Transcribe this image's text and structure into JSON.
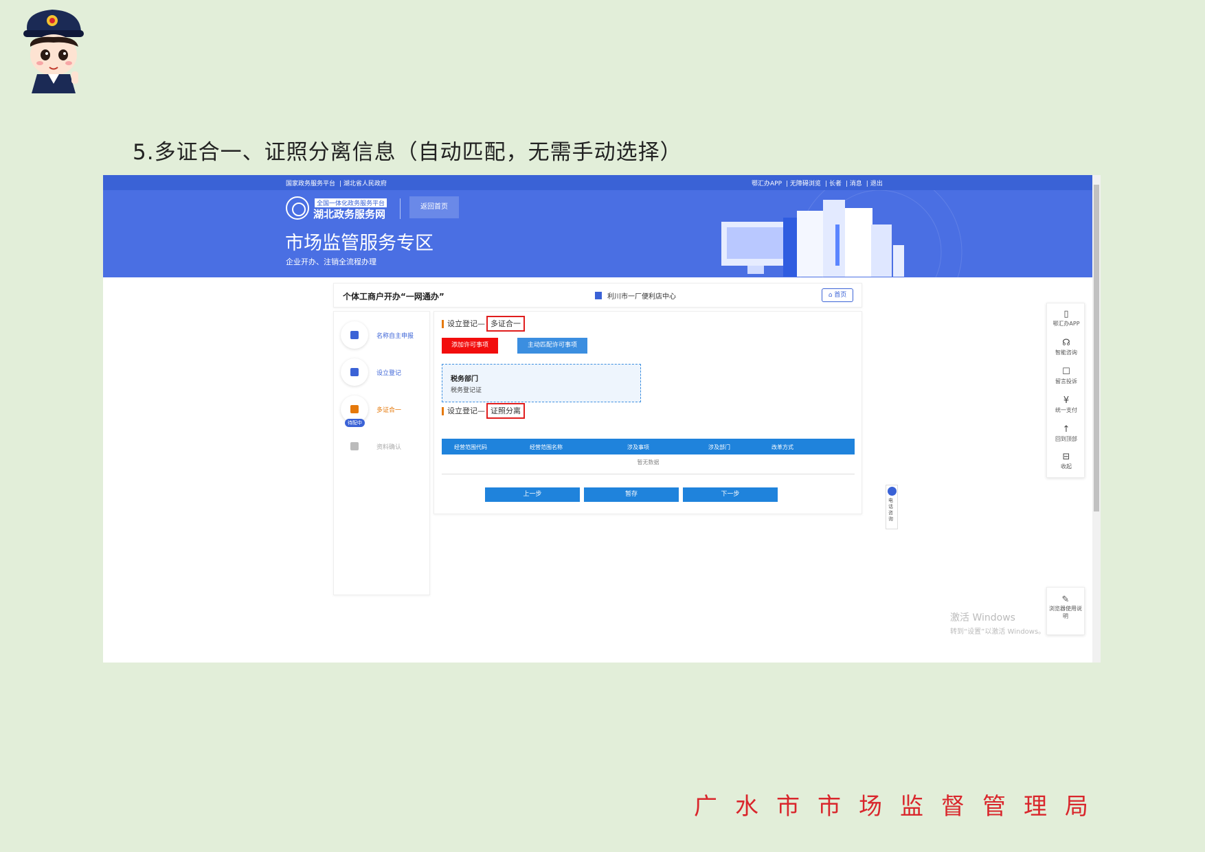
{
  "slide": {
    "title": "5.多证合一、证照分离信息（自动匹配，无需手动选择）",
    "footer": "广水市市场监督管理局"
  },
  "portal": {
    "top_left": [
      "国家政务服务平台",
      "湖北省人民政府"
    ],
    "top_right": [
      "鄂汇办APP",
      "无障碍浏览",
      "长者",
      "消息",
      "退出"
    ],
    "site_sub": "全国一体化政务服务平台",
    "site_name": "湖北政务服务网",
    "back_home": "返回首页",
    "zone_title": "市场监管服务专区",
    "zone_sub": "企业开办、注销全流程办理"
  },
  "header": {
    "title": "个体工商户开办“一网通办”",
    "location": "利川市一厂便利店中心",
    "home": "首页"
  },
  "steps": [
    {
      "label": "名称自主申报",
      "state": "done"
    },
    {
      "label": "设立登记",
      "state": "done"
    },
    {
      "label": "多证合一",
      "state": "active"
    },
    {
      "label": "资料确认",
      "state": "todo"
    }
  ],
  "active_badge": "待配中",
  "section1": {
    "prefix": "设立登记",
    "highlight": "多证合一"
  },
  "buttons": {
    "add_permit": "添加许可事项",
    "auto_match": "主动匹配许可事项"
  },
  "tax_box": {
    "title": "税务部门",
    "item": "税务登记证"
  },
  "section2": {
    "prefix": "设立登记",
    "highlight": "证照分离"
  },
  "table": {
    "headers": [
      "经营范围代码",
      "经营范围名称",
      "涉及事项",
      "涉及部门",
      "改革方式"
    ],
    "empty": "暂无数据"
  },
  "nav": {
    "prev": "上一步",
    "save": "暂存",
    "next": "下一步"
  },
  "tools": [
    {
      "icon": "phone-icon",
      "glyph": "▯",
      "label": "鄂汇办APP"
    },
    {
      "icon": "headset-icon",
      "glyph": "☊",
      "label": "智能咨询"
    },
    {
      "icon": "comment-icon",
      "glyph": "☐",
      "label": "留言投诉"
    },
    {
      "icon": "yuan-icon",
      "glyph": "¥",
      "label": "统一支付"
    },
    {
      "icon": "top-icon",
      "glyph": "↑",
      "label": "回到顶部"
    },
    {
      "icon": "collapse-icon",
      "glyph": "⊟",
      "label": "收起"
    }
  ],
  "phone_tab": "电话咨询",
  "guide": "浏览器使用说明",
  "activate": {
    "line1": "激活 Windows",
    "line2": "转到“设置”以激活 Windows。"
  },
  "colors": {
    "primary": "#3a62d6",
    "banner": "#4a6fe3",
    "highlight_red": "#e01c1c",
    "table_blue": "#1f83dc",
    "slide_bg": "#e2eed9"
  }
}
